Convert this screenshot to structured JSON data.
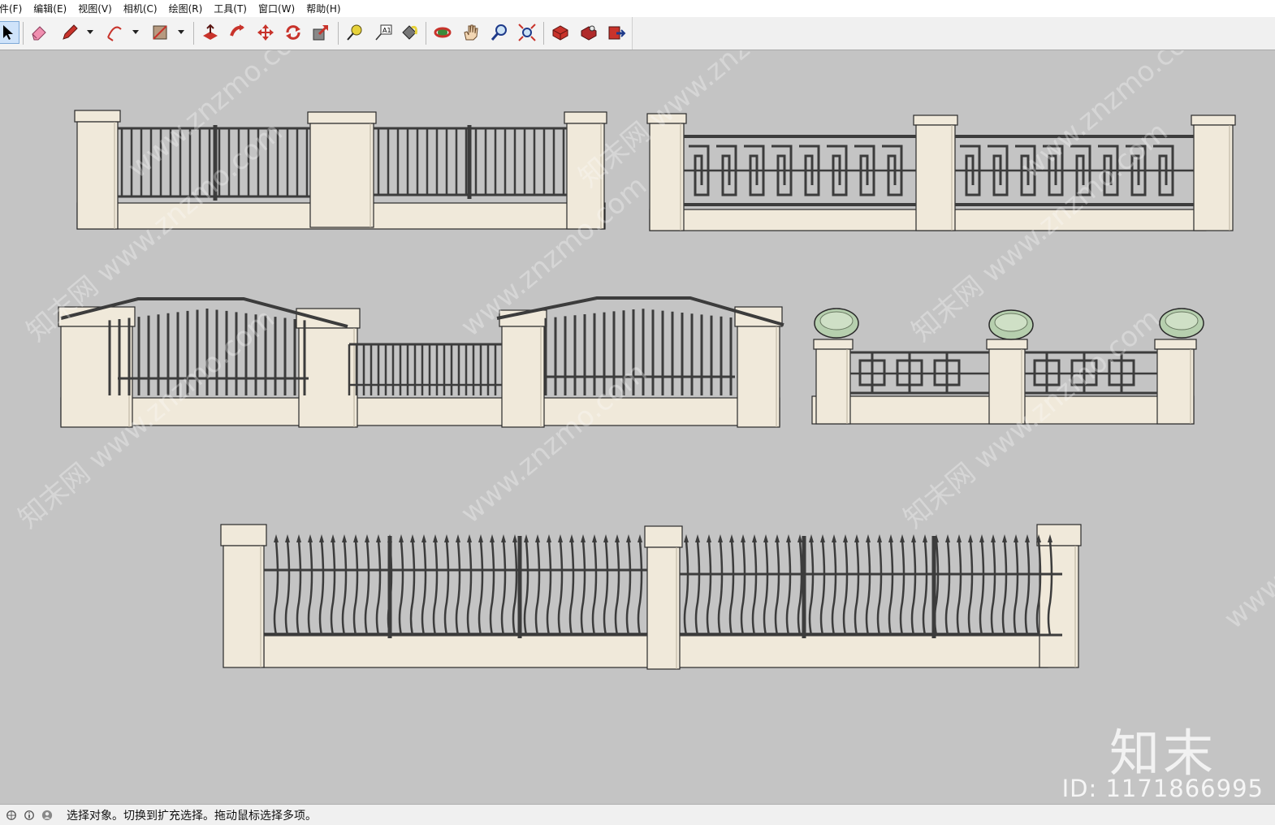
{
  "menu": [
    "件(F)",
    "编辑(E)",
    "视图(V)",
    "相机(C)",
    "绘图(R)",
    "工具(T)",
    "窗口(W)",
    "帮助(H)"
  ],
  "toolbar": {
    "tools": [
      "select-icon",
      "eraser-icon",
      "pencil-icon",
      "arc-icon",
      "rectangle-icon",
      "push-pull-icon",
      "follow-me-icon",
      "move-icon",
      "rotate-icon",
      "scale-icon",
      "tape-measure-icon",
      "text-icon",
      "paint-bucket-icon",
      "orbit-icon",
      "pan-icon",
      "zoom-icon",
      "zoom-extents-icon",
      "components-icon",
      "materials-icon",
      "export-icon"
    ],
    "active": "select-icon"
  },
  "watermark": {
    "site": "www.znzmo.com",
    "brand": "知末网",
    "logo": "知末",
    "id": "ID: 1171866995"
  },
  "status": {
    "text": "选择对象。切换到扩充选择。拖动鼠标选择多项。"
  },
  "colors": {
    "viewport": "#c4c4c4",
    "stone": "#f0e9da",
    "iron": "#3c3c3c",
    "lamp_glass": "#b6cfae"
  }
}
